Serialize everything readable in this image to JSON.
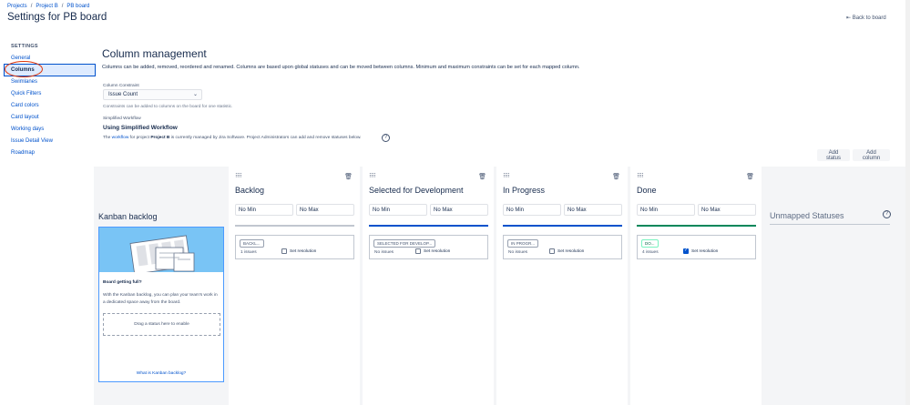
{
  "breadcrumb": [
    "Projects",
    "Project B",
    "PB board"
  ],
  "page_title": "Settings for PB board",
  "back_link": "Back to board",
  "sidebar": {
    "heading": "SETTINGS",
    "items": [
      {
        "label": "General",
        "active": false
      },
      {
        "label": "Columns",
        "active": true
      },
      {
        "label": "Swimlanes",
        "active": false
      },
      {
        "label": "Quick Filters",
        "active": false
      },
      {
        "label": "Card colors",
        "active": false
      },
      {
        "label": "Card layout",
        "active": false
      },
      {
        "label": "Working days",
        "active": false
      },
      {
        "label": "Issue Detail View",
        "active": false
      },
      {
        "label": "Roadmap",
        "active": false
      }
    ]
  },
  "main": {
    "title": "Column management",
    "description": "Columns can be added, removed, reordered and renamed. Columns are based upon global statuses and can be moved between columns. Minimum and maximum constraints can be set for each mapped column.",
    "constraint_label": "Column Constraint",
    "constraint_value": "Issue Count",
    "constraint_help": "Constraints can be added to columns on the board for one statistic.",
    "workflow_label": "Simplified Workflow",
    "workflow_title": "Using Simplified Workflow",
    "workflow_desc_pre": "The",
    "workflow_desc_link": "workflow",
    "workflow_desc_mid": "for project",
    "workflow_desc_project": "Project B",
    "workflow_desc_post": "is currently managed by Jira Software. Project Administrators can add and remove statuses below.",
    "add_status": "Add status",
    "add_column": "Add column"
  },
  "backlog": {
    "title": "Kanban backlog",
    "heading": "Board getting full?",
    "text": "With the Kanban backlog, you can plan your team's work in a dedicated space away from the board.",
    "drop_hint": "Drag a status here to enable",
    "link": "What is Kanban backlog?"
  },
  "columns": [
    {
      "name": "Backlog",
      "min_placeholder": "No Min",
      "max_placeholder": "No Max",
      "bar_color": "#c1c7d0",
      "status": "BACKL...",
      "issues": "1 issues",
      "resolution_label": "Set resolution",
      "resolution_checked": false
    },
    {
      "name": "Selected for Development",
      "min_placeholder": "No Min",
      "max_placeholder": "No Max",
      "bar_color": "#0052cc",
      "status": "SELECTED FOR DEVELOP...",
      "issues": "No issues",
      "resolution_label": "Set resolution",
      "resolution_checked": false
    },
    {
      "name": "In Progress",
      "min_placeholder": "No Min",
      "max_placeholder": "No Max",
      "bar_color": "#0052cc",
      "status": "IN PROGR...",
      "issues": "No issues",
      "resolution_label": "Set resolution",
      "resolution_checked": false
    },
    {
      "name": "Done",
      "min_placeholder": "No Min",
      "max_placeholder": "No Max",
      "bar_color": "#00875a",
      "status": "DO...",
      "issues": "4 issues",
      "resolution_label": "Set resolution",
      "resolution_checked": true
    }
  ],
  "unmapped": {
    "title": "Unmapped Statuses"
  },
  "icons": {
    "grip": "grip-dots-icon",
    "trash": "trash-icon",
    "help": "help-circle-icon",
    "back": "arrow-back-icon",
    "chevron": "chevron-down-icon"
  }
}
